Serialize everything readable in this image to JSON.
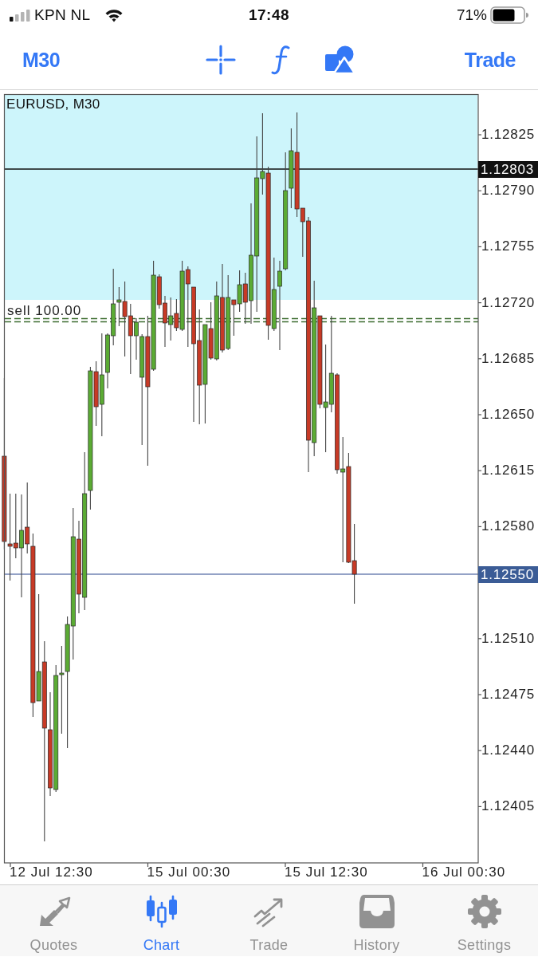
{
  "status_bar": {
    "carrier": "KPN NL",
    "time": "17:48",
    "battery": "71%"
  },
  "toolbar": {
    "timeframe": "M30",
    "action": "Trade"
  },
  "chart": {
    "title": "EURUSD, M30",
    "order_label": "sell 100.00",
    "price_ticks": [
      "1.12825",
      "1.12790",
      "1.12755",
      "1.12720",
      "1.12685",
      "1.12650",
      "1.12615",
      "1.12580",
      "1.12510",
      "1.12475",
      "1.12440",
      "1.12405"
    ],
    "price_tags": [
      {
        "kind": "level",
        "text": "1.12803"
      },
      {
        "kind": "bid",
        "text": "1.12550"
      }
    ],
    "time_ticks": [
      "12 Jul 12:30",
      "15 Jul 00:30",
      "15 Jul 12:30",
      "16 Jul 00:30"
    ]
  },
  "tab_bar": {
    "tabs": [
      {
        "kind": "quotes",
        "label": "Quotes",
        "selected": false
      },
      {
        "kind": "chart",
        "label": "Chart",
        "selected": true
      },
      {
        "kind": "trade",
        "label": "Trade",
        "selected": false
      },
      {
        "kind": "history",
        "label": "History",
        "selected": false
      },
      {
        "kind": "settings",
        "label": "Settings",
        "selected": false
      }
    ]
  }
}
